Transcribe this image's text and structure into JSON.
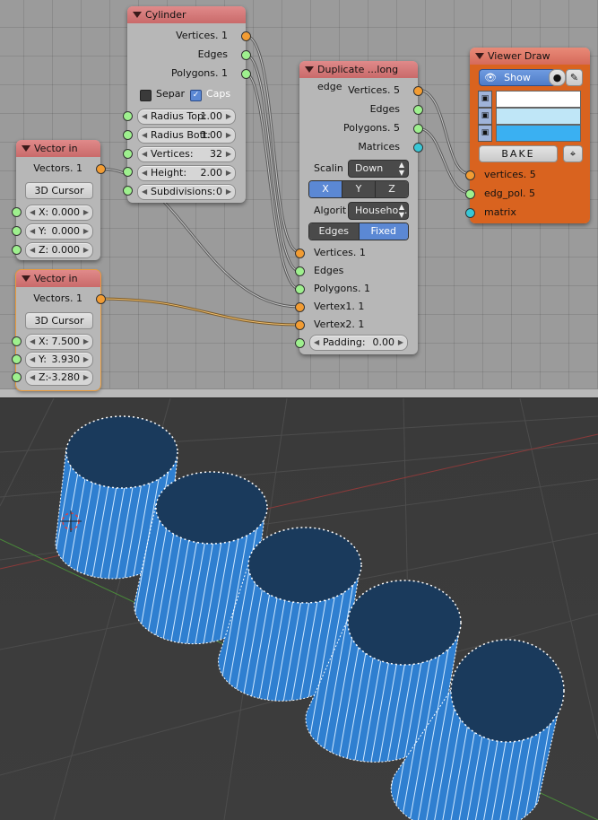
{
  "nodes": {
    "cylinder": {
      "title": "Cylinder",
      "outputs": [
        "Vertices. 1",
        "Edges",
        "Polygons. 1"
      ],
      "separate_label": "Separ",
      "caps_label": "Caps",
      "fields": [
        {
          "label": "Radius Top:",
          "value": "1.00"
        },
        {
          "label": "Radius Bott:",
          "value": "1.00"
        },
        {
          "label": "Vertices:",
          "value": "32"
        },
        {
          "label": "Height:",
          "value": "2.00"
        },
        {
          "label": "Subdivisions:",
          "value": "0"
        }
      ]
    },
    "vector_in_1": {
      "title": "Vector in",
      "output": "Vectors. 1",
      "cursor_button": "3D Cursor",
      "fields": [
        {
          "label": "X:",
          "value": "0.000"
        },
        {
          "label": "Y:",
          "value": "0.000"
        },
        {
          "label": "Z:",
          "value": "0.000"
        }
      ]
    },
    "vector_in_2": {
      "title": "Vector in",
      "output": "Vectors. 1",
      "cursor_button": "3D Cursor",
      "fields": [
        {
          "label": "X:",
          "value": "7.500"
        },
        {
          "label": "Y:",
          "value": "3.930"
        },
        {
          "label": "Z:",
          "value": "-3.280"
        }
      ]
    },
    "duplicate": {
      "title": "Duplicate ...long edge",
      "outputs": [
        "Vertices. 5",
        "Edges",
        "Polygons. 5",
        "Matrices"
      ],
      "scaling_label": "Scalin",
      "scaling_value": "Down",
      "axes": [
        "X",
        "Y",
        "Z"
      ],
      "algorithm_label": "Algorit",
      "algorithm_value": "Househo...",
      "mode": [
        "Edges",
        "Fixed"
      ],
      "inputs": [
        "Vertices. 1",
        "Edges",
        "Polygons. 1",
        "Vertex1. 1",
        "Vertex2. 1"
      ],
      "padding_label": "Padding:",
      "padding_value": "0.00"
    },
    "viewer": {
      "title": "Viewer Draw",
      "show_label": "Show",
      "bake_label": "BAKE",
      "inputs": [
        "vertices. 5",
        "edg_pol. 5",
        "matrix"
      ],
      "swatch_colors": [
        "#ffffff",
        "#bfe6f7",
        "#3ab0f2"
      ]
    }
  },
  "colors": {
    "socket_vertices": "#f29c33",
    "socket_data": "#9ef08e",
    "socket_matrix": "#39c7d6",
    "viewer_body": "#d9631f",
    "mesh_side": "#2f7fd0",
    "mesh_cap": "#1a3a5c"
  }
}
